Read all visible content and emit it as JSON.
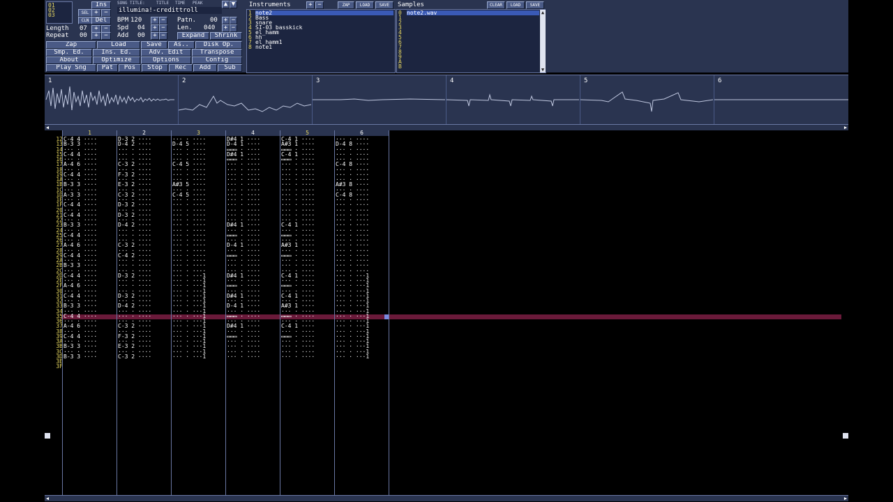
{
  "position_block": {
    "rows": [
      "00",
      "01",
      "02",
      "03"
    ],
    "ins_label": "Ins",
    "del_label": "Del",
    "cln_label": "CLN",
    "sel_label": "SEL"
  },
  "song": {
    "title_label": "SONG TITLE:",
    "title_value": "illumina!-credittroll",
    "title_mode_label": "TITLE",
    "time_label": "TIME",
    "peak_label": "PEAK"
  },
  "params": {
    "length_label": "Length",
    "length_value": "07",
    "repeat_label": "Repeat",
    "repeat_value": "00",
    "bpm_label": "BPM",
    "bpm_value": "120",
    "spd_label": "Spd",
    "spd_value": "04",
    "add_label": "Add",
    "add_value": "00",
    "patn_label": "Patn.",
    "patn_value": "00",
    "len_label": "Len.",
    "len_value": "040",
    "expand_label": "Expand",
    "shrink_label": "Shrink"
  },
  "toolbar": {
    "row1": [
      "Zap",
      "Load",
      "Save",
      "As..",
      "Disk Op."
    ],
    "row2": [
      "Smp. Ed.",
      "Ins. Ed.",
      "Adv. Edit",
      "Transpose"
    ],
    "row3": [
      "About",
      "Optimize",
      "Options",
      "Config"
    ],
    "row4": [
      "Play Sng",
      "Pat",
      "Pos",
      "Stop",
      "Rec",
      "Add",
      "Sub"
    ]
  },
  "instruments": {
    "title": "Instruments",
    "zap_label": "ZAP",
    "load_label": "LOAD",
    "save_label": "SAVE",
    "numbers": "1\n2\n3\n4\n5\n6\n7\n8",
    "items": "note2\nBass\nsnare\nSI-03 basskick\nel_hamm\nhh\nel_hamm1\nnote1"
  },
  "samples": {
    "title": "Samples",
    "clear_label": "CLEAR",
    "load_label": "LOAD",
    "save_label": "SAVE",
    "numbers": "0\n1\n2\n3\n4\n5\n6\n7\n8\n9\nA\nB",
    "items": "note2.wav"
  },
  "scopes": [
    "1",
    "2",
    "3",
    "4",
    "5",
    "6"
  ],
  "pattern": {
    "channels": [
      "1",
      "2",
      "3",
      "4",
      "5",
      "6"
    ],
    "rows": "12\n13\n14\n15\n16\n17\n18\n19\n1A\n1B\n1C\n1D\n1E\n1F\n20\n21\n22\n23\n24\n25\n26\n27\n28\n29\n2A\n2B\n2C\n2D\n2E\n2F\n30\n31\n32\n33\n34\n35\n36\n37\n38\n39\n3A\n3B\n3C\n3D\n3E\n3F",
    "ch1": "C-4 4 ····\nB-3 3 ····\n··· · ····\nC-4 4 ····\n··· · ····\nA-4 6 ····\n··· · ····\nC-4 4 ····\n··· · ····\nB-3 3 ····\n··· · ····\nA-3 3 ····\n··· · ····\nC-4 4 ····\n··· · ····\nC-4 4 ····\n··· · ····\nB-3 3 ····\n··· · ····\nC-4 4 ····\n··· · ····\nA-4 6 ····\n··· · ····\nC-4 4 ····\n··· · ····\nB-3 3 ····\n··· · ····\nC-4 4 ····\n··· · ····\nA-4 6 ····\n··· · ····\nC-4 4 ····\n··· · ····\nB-3 3 ····\n··· · ····\nC-4 4 ····\n··· · ····\nA-4 6 ····\n··· · ····\nC-4 4 ····\n··· · ····\nB-3 3 ····\n··· · ····\nB-3 3 ····",
    "ch2": "D-3 2 ····\nD-4 2 ····\n··· · ····\n··· · ····\n··· · ····\nC-3 2 ····\n··· · ····\nF-3 2 ····\n··· · ····\nE-3 2 ····\n··· · ····\nC-3 2 ····\n··· · ····\nD-3 2 ····\n··· · ····\nD-3 2 ····\n··· · ····\nD-4 2 ····\n··· · ····\n··· · ····\n··· · ····\nC-3 2 ····\n··· · ····\nC-4 2 ····\n··· · ····\n··· · ····\n··· · ····\nD-3 2 ····\n··· · ····\n··· · ····\n··· · ····\nD-3 2 ····\n··· · ····\nD-4 2 ····\n··· · ····\n··· · ····\n··· · ····\nC-3 2 ····\n··· · ····\nF-3 2 ····\n··· · ····\nE-3 2 ····\n··· · ····\nC-3 2 ····",
    "ch3": "··· · ····\nD-4 5 ····\n··· · ····\n··· · ····\n··· · ····\nC-4 5 ····\n··· · ····\n··· · ····\n··· · ····\nA#3 5 ····\n··· · ····\nC-4 5 ····\n··· · ····\n··· · ····\n··· · ····\n··· · ····\n··· · ····\n··· · ····\n··· · ····\n··· · ····\n··· · ····\n··· · ····\n··· · ····\n··· · ····\n··· · ····\n··· · ····\n··· · ····\n··· · ···1\n··· · ···1\n··· · ···1\n··· · ···1\n··· · ···1\n··· · ···1\n··· · ···1\n··· · ···1\n··· · ···1\n··· · ···1\n··· · ···1\n··· · ···1\n··· · ···1\n··· · ···1\n··· · ···1\n··· · ···1\n··· · ···1",
    "ch4": "D#4 1 ····\nD-4 1 ····\n▭▭▭ · ····\nD#4 1 ····\n▭▭▭ · ····\n··· · ····\n··· · ····\n··· · ····\n··· · ····\n··· · ····\n··· · ····\n··· · ····\n··· · ····\n··· · ····\n··· · ····\n··· · ····\n··· · ····\nD#4 1 ····\n··· · ····\n▭▭▭ · ····\n··· · ····\nD-4 1 ····\n··· · ····\n▭▭▭ · ····\n··· · ····\n··· · ····\n··· · ····\nD#4 1 ····\n··· · ····\n▭▭▭ · ····\n··· · ····\nD#4 1 ····\n··· · ····\nD-4 1 ····\n··· · ····\n▭▭▭ · ····\n··· · ····\nD#4 1 ····\n··· · ····\n▭▭▭ · ····\n··· · ····\n··· · ····\n··· · ····\n··· · ····",
    "ch5": "C-4 1 ····\nA#3 1 ····\n▭▭▭ · ····\nC-4 1 ····\n▭▭▭ · ····\n··· · ····\n··· · ····\n··· · ····\n··· · ····\n··· · ····\n··· · ····\n··· · ····\n··· · ····\n··· · ····\n··· · ····\n··· · ····\n··· · ····\nC-4 1 ····\n··· · ····\n▭▭▭ · ····\n··· · ····\nA#3 1 ····\n··· · ····\n▭▭▭ · ····\n··· · ····\n··· · ····\n··· · ····\nC-4 1 ····\n··· · ····\n▭▭▭ · ····\n··· · ····\nC-4 1 ····\n··· · ····\nA#3 1 ····\n··· · ····\n▭▭▭ · ····\n··· · ····\nC-4 1 ····\n··· · ····\n▭▭▭ · ····\n··· · ····\n··· · ····\n··· · ····\n··· · ····",
    "ch6": "··· · ····\nD-4 8 ····\n··· · ····\n··· · ····\n··· · ····\nC-4 8 ····\n··· · ····\n··· · ····\n··· · ····\nA#3 8 ····\n··· · ····\nC-4 8 ····\n··· · ····\n··· · ····\n··· · ····\n··· · ····\n··· · ····\n··· · ····\n··· · ····\n··· · ····\n··· · ····\n··· · ····\n··· · ····\n··· · ····\n··· · ····\n··· · ····\n··· · ····\n··· · ···1\n··· · ···1\n··· · ···1\n··· · ···1\n··· · ···1\n··· · ···1\n··· · ···1\n··· · ···1\n··· · ···1\n··· · ···1\n··· · ···1\n··· · ···1\n··· · ···1\n··· · ···1\n··· · ···1\n··· · ···1\n··· · ···1"
  },
  "colors": {
    "panel": "#2a3450",
    "button": "#4a5a86",
    "cursor_row": "#6a1a3a",
    "row_numbers": "#e8d860"
  }
}
